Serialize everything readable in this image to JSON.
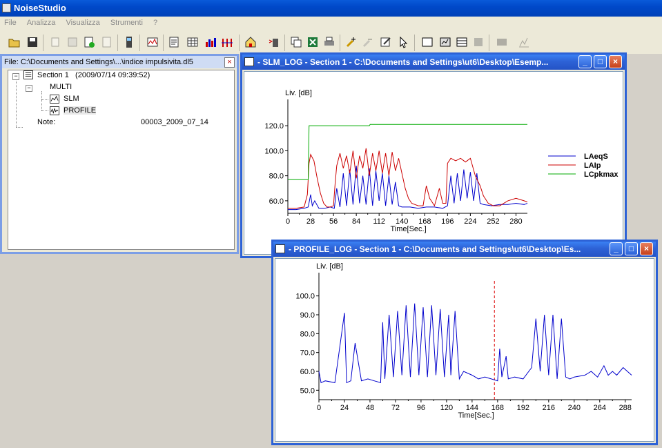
{
  "app": {
    "title": "NoiseStudio"
  },
  "menu": [
    "File",
    "Analizza",
    "Visualizza",
    "Strumenti",
    "?"
  ],
  "file_window": {
    "title": "File: C:\\Documents and Settings\\...\\indice impulsivita.dl5",
    "section_label": "Section 1",
    "section_date": "(2009/07/14 09:39:52)",
    "multi_label": "MULTI",
    "slm_label": "SLM",
    "profile_label": "PROFILE",
    "note_label": "Note:",
    "note_value": "00003_2009_07_14"
  },
  "slm_window": {
    "title": "- SLM_LOG - Section 1 -  C:\\Documents and Settings\\ut6\\Desktop\\Esemp..."
  },
  "profile_window": {
    "title": "- PROFILE_LOG - Section 1 -  C:\\Documents and Settings\\ut6\\Desktop\\Es..."
  },
  "colors": {
    "laeq": "#0000cc",
    "laip": "#cc0000",
    "lcpk": "#00aa00",
    "titlebar": "#2d62d6"
  },
  "chart_data": [
    {
      "type": "line",
      "ylabel": "Liv. [dB]",
      "xlabel": "Time[Sec.]",
      "xlim": [
        0,
        294
      ],
      "ylim": [
        50,
        130
      ],
      "yticks": [
        60.0,
        80.0,
        100.0,
        120.0
      ],
      "xticks": [
        0,
        28,
        56,
        84,
        112,
        140,
        168,
        196,
        224,
        252,
        280
      ],
      "legend_position": "right",
      "series": [
        {
          "name": "LAeqS",
          "color": "#0000cc",
          "x": [
            0,
            10,
            20,
            25,
            28,
            30,
            33,
            38,
            45,
            52,
            57,
            60,
            64,
            68,
            72,
            76,
            80,
            84,
            88,
            92,
            96,
            100,
            104,
            108,
            112,
            116,
            120,
            124,
            128,
            132,
            136,
            140,
            150,
            160,
            170,
            180,
            190,
            196,
            200,
            204,
            208,
            212,
            216,
            220,
            224,
            228,
            232,
            236,
            240,
            250,
            260,
            270,
            280,
            290,
            294
          ],
          "y": [
            53,
            53,
            54,
            55,
            65,
            56,
            60,
            54,
            54,
            55,
            54,
            70,
            55,
            82,
            56,
            85,
            57,
            88,
            58,
            80,
            57,
            86,
            56,
            84,
            60,
            82,
            56,
            80,
            57,
            75,
            56,
            55,
            55,
            54,
            55,
            55,
            54,
            56,
            80,
            58,
            82,
            60,
            85,
            62,
            83,
            60,
            82,
            58,
            57,
            56,
            57,
            57,
            58,
            57,
            58
          ]
        },
        {
          "name": "LAIp",
          "color": "#cc0000",
          "x": [
            0,
            10,
            20,
            24,
            26,
            28,
            32,
            36,
            40,
            44,
            48,
            52,
            56,
            58,
            60,
            64,
            68,
            72,
            76,
            80,
            84,
            88,
            92,
            96,
            100,
            104,
            108,
            112,
            116,
            120,
            124,
            128,
            132,
            136,
            140,
            144,
            148,
            152,
            160,
            166,
            170,
            174,
            178,
            180,
            186,
            190,
            194,
            196,
            200,
            206,
            212,
            218,
            224,
            230,
            236,
            240,
            246,
            252,
            260,
            270,
            280,
            290,
            294
          ],
          "y": [
            54,
            54,
            55,
            65,
            90,
            97,
            92,
            78,
            66,
            58,
            55,
            55,
            56,
            74,
            88,
            98,
            86,
            96,
            82,
            100,
            78,
            96,
            86,
            102,
            80,
            98,
            84,
            100,
            82,
            98,
            80,
            99,
            84,
            94,
            82,
            70,
            62,
            58,
            56,
            56,
            72,
            62,
            58,
            56,
            70,
            58,
            58,
            90,
            94,
            92,
            94,
            91,
            94,
            80,
            72,
            64,
            58,
            56,
            56,
            60,
            62,
            60,
            59
          ]
        },
        {
          "name": "LCpkmax",
          "color": "#00aa00",
          "x": [
            0,
            25,
            26,
            100,
            101,
            294
          ],
          "y": [
            77,
            77,
            120,
            120,
            121,
            121
          ]
        }
      ]
    },
    {
      "type": "line",
      "ylabel": "Liv. [dB]",
      "xlabel": "Time[Sec.]",
      "xlim": [
        0,
        294
      ],
      "ylim": [
        45,
        105
      ],
      "yticks": [
        50.0,
        60.0,
        70.0,
        80.0,
        90.0,
        100.0
      ],
      "xticks": [
        0,
        24,
        48,
        72,
        96,
        120,
        144,
        168,
        192,
        216,
        240,
        264,
        288
      ],
      "cursor_x": 165,
      "series": [
        {
          "name": "PROFILE",
          "color": "#0000cc",
          "x": [
            0,
            2,
            6,
            15,
            24,
            26,
            30,
            34,
            40,
            46,
            52,
            58,
            60,
            62,
            66,
            70,
            74,
            78,
            82,
            86,
            90,
            94,
            98,
            102,
            106,
            110,
            114,
            118,
            122,
            124,
            128,
            132,
            136,
            144,
            150,
            156,
            162,
            168,
            170,
            172,
            176,
            178,
            184,
            192,
            200,
            204,
            208,
            212,
            216,
            220,
            224,
            228,
            232,
            236,
            240,
            250,
            256,
            262,
            268,
            272,
            276,
            280,
            286,
            294
          ],
          "y": [
            60,
            54,
            55,
            54,
            91,
            54,
            55,
            75,
            55,
            56,
            55,
            54,
            86,
            56,
            90,
            57,
            92,
            58,
            95,
            57,
            96,
            58,
            94,
            57,
            95,
            58,
            93,
            57,
            90,
            58,
            92,
            56,
            60,
            58,
            56,
            57,
            56,
            55,
            72,
            57,
            68,
            56,
            57,
            56,
            62,
            88,
            60,
            90,
            58,
            90,
            56,
            88,
            57,
            56,
            57,
            58,
            60,
            57,
            63,
            58,
            60,
            58,
            62,
            58
          ]
        }
      ]
    }
  ]
}
